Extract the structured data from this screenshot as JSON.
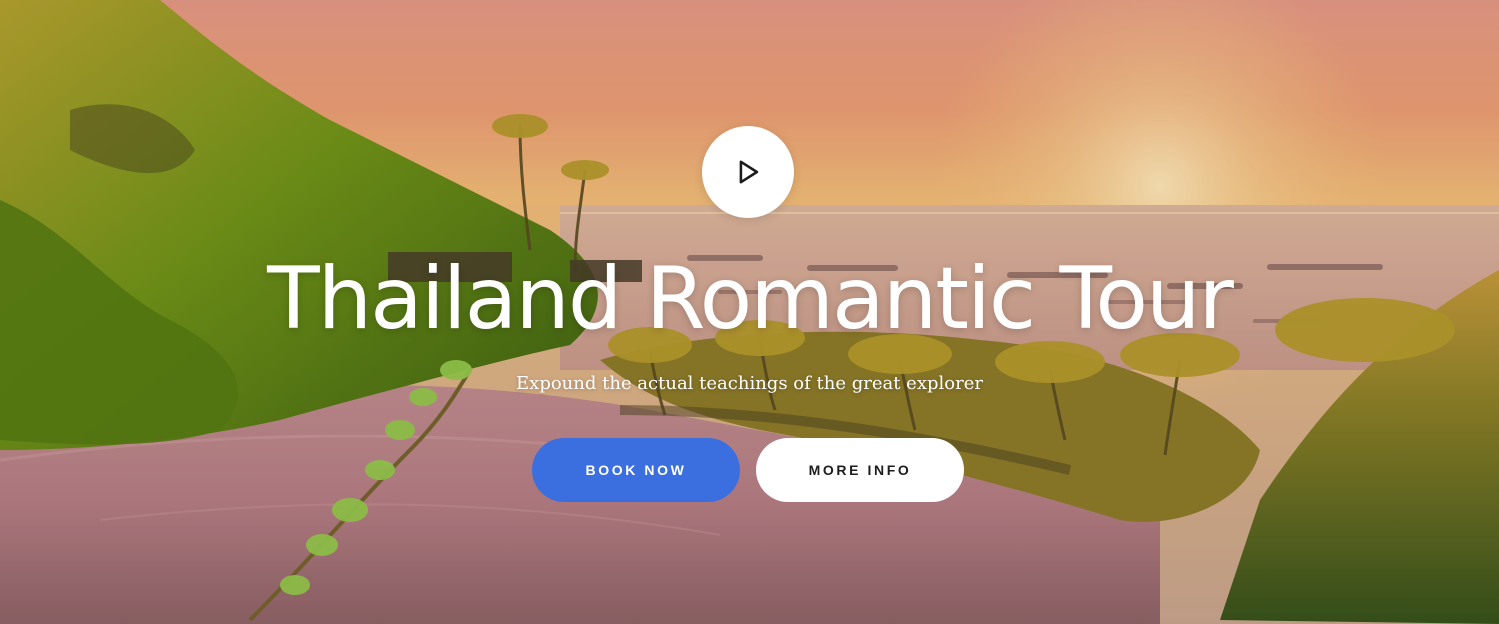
{
  "hero": {
    "title": "Thailand Romantic Tour",
    "subtitle": "Expound the actual teachings of the great explorer",
    "play_icon": "play-icon",
    "background_scene": "tropical-beach-sunset"
  },
  "buttons": {
    "book_now": "BOOK NOW",
    "more_info": "MORE INFO"
  },
  "colors": {
    "primary_button": "#3b6fe0",
    "secondary_button": "#ffffff",
    "title_text": "#ffffff"
  }
}
